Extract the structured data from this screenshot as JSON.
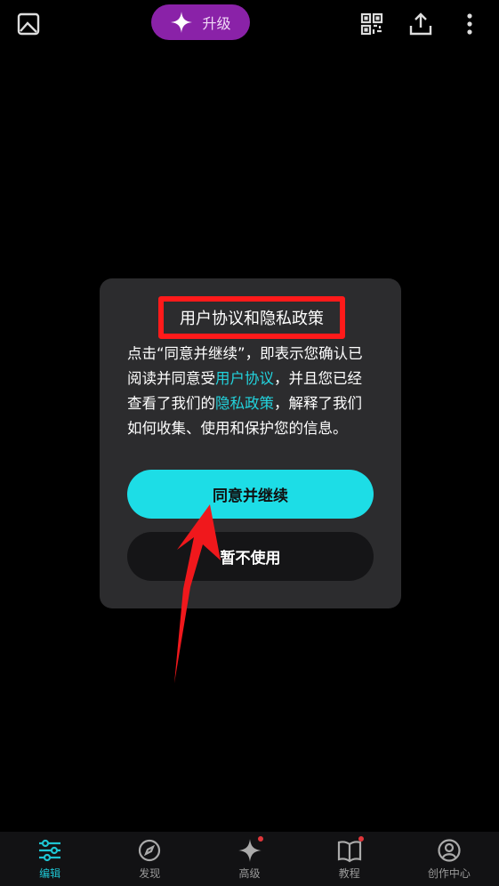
{
  "header": {
    "upgrade_label": "升级"
  },
  "dialog": {
    "title": "用户协议和隐私政策",
    "body_part1": "点击“同意并继续”，即表示您确认已阅读并同意受",
    "link_terms": "用户协议",
    "body_part2": "，并且您已经查看了我们的",
    "link_privacy": "隐私政策",
    "body_part3": "，解释了我们如何收集、使用和保护您的信息。",
    "agree_label": "同意并继续",
    "decline_label": "暂不使用"
  },
  "colors": {
    "accent": "#1ddde6",
    "upgrade_bg": "#8a22a8",
    "annotation_red": "#ff1a1a"
  },
  "bottom_nav": {
    "items": [
      {
        "label": "编辑",
        "icon": "sliders-icon",
        "active": true
      },
      {
        "label": "发现",
        "icon": "compass-icon",
        "active": false
      },
      {
        "label": "高级",
        "icon": "sparkle-icon",
        "active": false,
        "badge": true
      },
      {
        "label": "教程",
        "icon": "book-icon",
        "active": false,
        "badge": true
      },
      {
        "label": "创作中心",
        "icon": "profile-icon",
        "active": false
      }
    ]
  }
}
